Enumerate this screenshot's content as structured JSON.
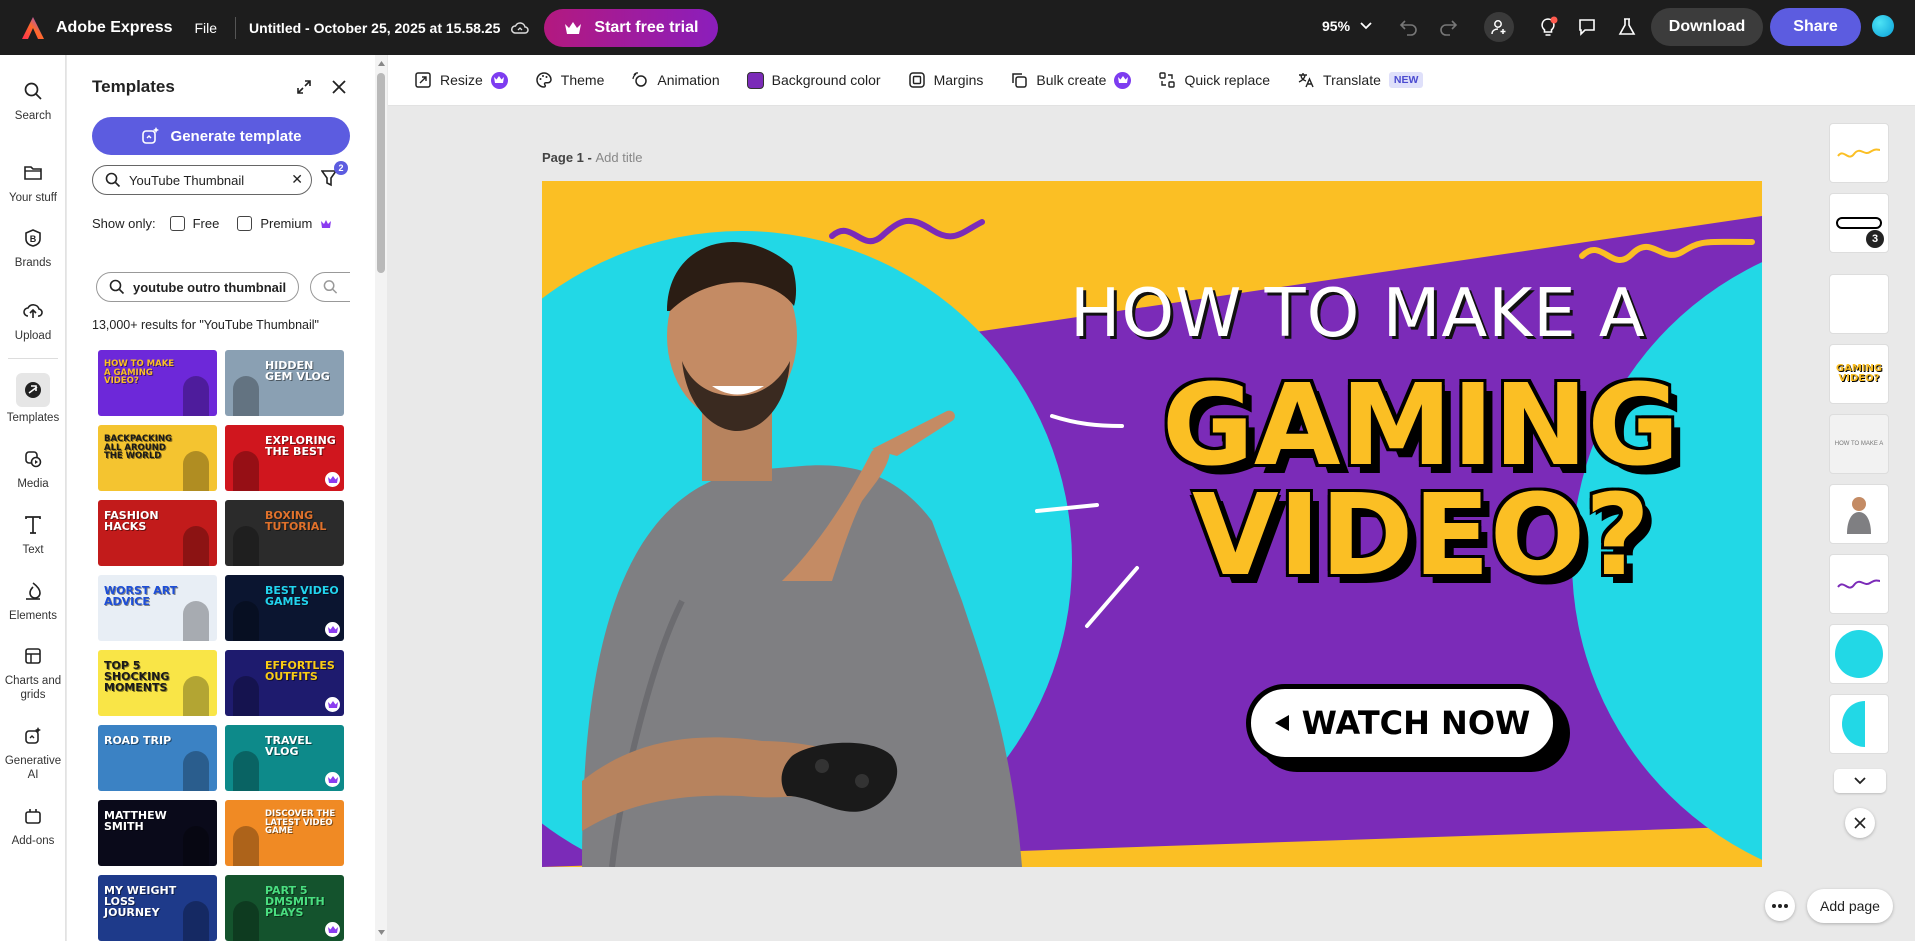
{
  "app": {
    "name": "Adobe Express",
    "file_menu": "File",
    "doc_title": "Untitled - October 25, 2025 at 15.58.25",
    "trial": "Start free trial",
    "zoom": "95%",
    "download": "Download",
    "share": "Share"
  },
  "rail": [
    {
      "key": "search",
      "label": "Search",
      "icon": "search-icon"
    },
    {
      "key": "your_stuff",
      "label": "Your stuff",
      "icon": "folder-icon"
    },
    {
      "key": "brands",
      "label": "Brands",
      "icon": "brand-icon"
    },
    {
      "key": "upload",
      "label": "Upload",
      "icon": "upload-icon"
    },
    {
      "key": "templates",
      "label": "Templates",
      "icon": "templates-icon"
    },
    {
      "key": "media",
      "label": "Media",
      "icon": "media-icon"
    },
    {
      "key": "text",
      "label": "Text",
      "icon": "text-icon"
    },
    {
      "key": "elements",
      "label": "Elements",
      "icon": "elements-icon"
    },
    {
      "key": "charts",
      "label": "Charts and grids",
      "icon": "charts-icon"
    },
    {
      "key": "genai",
      "label": "Generative AI",
      "icon": "genai-icon"
    },
    {
      "key": "addons",
      "label": "Add-ons",
      "icon": "addons-icon"
    }
  ],
  "panel": {
    "title": "Templates",
    "generate": "Generate template",
    "search_value": "YouTube Thumbnail",
    "filter_count": "2",
    "show_only": "Show only:",
    "free": "Free",
    "premium": "Premium",
    "chip1": "youtube outro thumbnail",
    "results": "13,000+ results for \"YouTube Thumbnail\""
  },
  "templates": [
    {
      "text": "How to make a Gaming Video?",
      "bg": "#6d28d9",
      "fg": "#fbbf24"
    },
    {
      "text": "Hidden Gem Vlog",
      "bg": "#8aa0b3",
      "fg": "#ffffff"
    },
    {
      "text": "Backpacking All Around The World",
      "bg": "#f4c430",
      "fg": "#1a1a1a"
    },
    {
      "text": "Exploring The Best",
      "bg": "#d0161e",
      "fg": "#ffffff"
    },
    {
      "text": "Fashion Hacks",
      "bg": "#c21b1b",
      "fg": "#ffffff"
    },
    {
      "text": "Boxing Tutorial",
      "bg": "#2b2b2b",
      "fg": "#e0712b"
    },
    {
      "text": "Worst Art Advice",
      "bg": "#e8eef5",
      "fg": "#1d4ed8"
    },
    {
      "text": "Best Video Games",
      "bg": "#0b1530",
      "fg": "#22d3ee"
    },
    {
      "text": "Top 5 Shocking Moments",
      "bg": "#f9e547",
      "fg": "#1a1a1a"
    },
    {
      "text": "Effortles Outfits",
      "bg": "#1e1b6e",
      "fg": "#facc15"
    },
    {
      "text": "Road Trip",
      "bg": "#3b82c4",
      "fg": "#ffffff"
    },
    {
      "text": "Travel Vlog",
      "bg": "#0d8a8a",
      "fg": "#ffffff"
    },
    {
      "text": "Matthew Smith",
      "bg": "#0a0a1a",
      "fg": "#ffffff"
    },
    {
      "text": "Discover The Latest Video Game",
      "bg": "#f08a24",
      "fg": "#ffffff"
    },
    {
      "text": "My Weight Loss Journey",
      "bg": "#1e3a8a",
      "fg": "#ffffff"
    },
    {
      "text": "Part 5 Dmsmith Plays",
      "bg": "#14532d",
      "fg": "#4ade80"
    }
  ],
  "toolbar": [
    {
      "key": "resize",
      "label": "Resize",
      "icon": "resize-icon",
      "premium": true
    },
    {
      "key": "theme",
      "label": "Theme",
      "icon": "theme-icon"
    },
    {
      "key": "animation",
      "label": "Animation",
      "icon": "animation-icon"
    },
    {
      "key": "bgcolor",
      "label": "Background color",
      "icon": "background-color-swatch"
    },
    {
      "key": "margins",
      "label": "Margins",
      "icon": "margins-icon"
    },
    {
      "key": "bulk",
      "label": "Bulk create",
      "icon": "bulk-create-icon",
      "premium": true
    },
    {
      "key": "quickreplace",
      "label": "Quick replace",
      "icon": "quick-replace-icon"
    },
    {
      "key": "translate",
      "label": "Translate",
      "icon": "translate-icon",
      "tag": "NEW"
    }
  ],
  "page": {
    "label": "Page 1 - ",
    "add_title": "Add title"
  },
  "design": {
    "line1": "HOW TO MAKE A",
    "line2": "GAMING",
    "line3": "VIDEO?",
    "cta": "WATCH NOW"
  },
  "layers": {
    "count_badge": "3",
    "text_preview": "HOW TO MAKE A",
    "gaming_preview": "GAMING VIDEO?"
  },
  "footer": {
    "add_page": "Add page"
  },
  "colors": {
    "accent": "#5c5ce0",
    "purple": "#7b2bb8",
    "cyan": "#22d8e6",
    "yellow": "#fbbf24"
  }
}
